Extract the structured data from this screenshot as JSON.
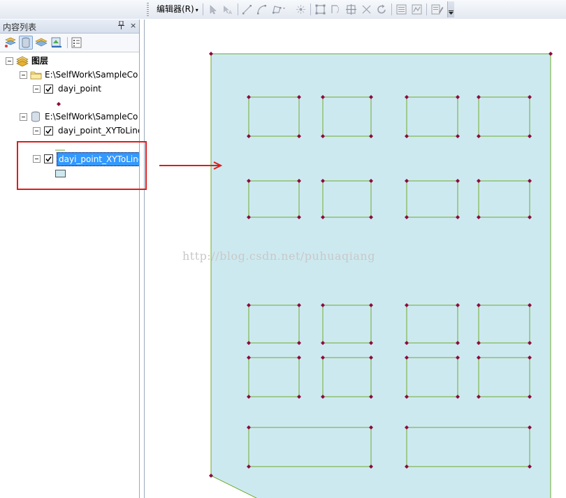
{
  "toolbar": {
    "editor_menu": {
      "label": "编辑器(R)",
      "caret": "▾"
    },
    "icons": [
      "edit-tool-icon",
      "edit-annotation-tool-icon",
      "straight-segment-icon",
      "end-point-arc-icon",
      "trace-icon",
      "point-icon",
      "edit-vertices-icon",
      "reshape-feature-icon",
      "cut-polygons-icon",
      "split-tool-icon",
      "rotate-tool-icon",
      "attributes-icon",
      "sketch-properties-icon",
      "create-features-icon"
    ]
  },
  "toc": {
    "title": "内容列表",
    "pin": "ᵖ",
    "close": "×",
    "tools": [
      "list-by-drawing-order-icon",
      "list-by-source-icon",
      "list-by-visibility-icon",
      "list-by-selection-icon",
      "options-icon"
    ],
    "root": {
      "label": "图层"
    },
    "sources": [
      {
        "label": "E:\\SelfWork\\SampleCo",
        "type": "folder",
        "layers": [
          {
            "label": "dayi_point",
            "checked": true,
            "symbol": "point"
          }
        ]
      },
      {
        "label": "E:\\SelfWork\\SampleCo",
        "type": "database",
        "layers": [
          {
            "label": "dayi_point_XYToLine",
            "checked": true,
            "symbol": "line"
          },
          {
            "label": "dayi_point_XYToLine",
            "checked": true,
            "symbol": "polygon",
            "selected": true
          }
        ]
      }
    ]
  },
  "map": {
    "watermark": "http://blog.csdn.net/puhuaqiang",
    "colors": {
      "fill": "#cde9f0",
      "line": "#6eaa2c",
      "vertex": "#8b0a3c"
    }
  },
  "annotation": {
    "color": "#e01b1b"
  }
}
